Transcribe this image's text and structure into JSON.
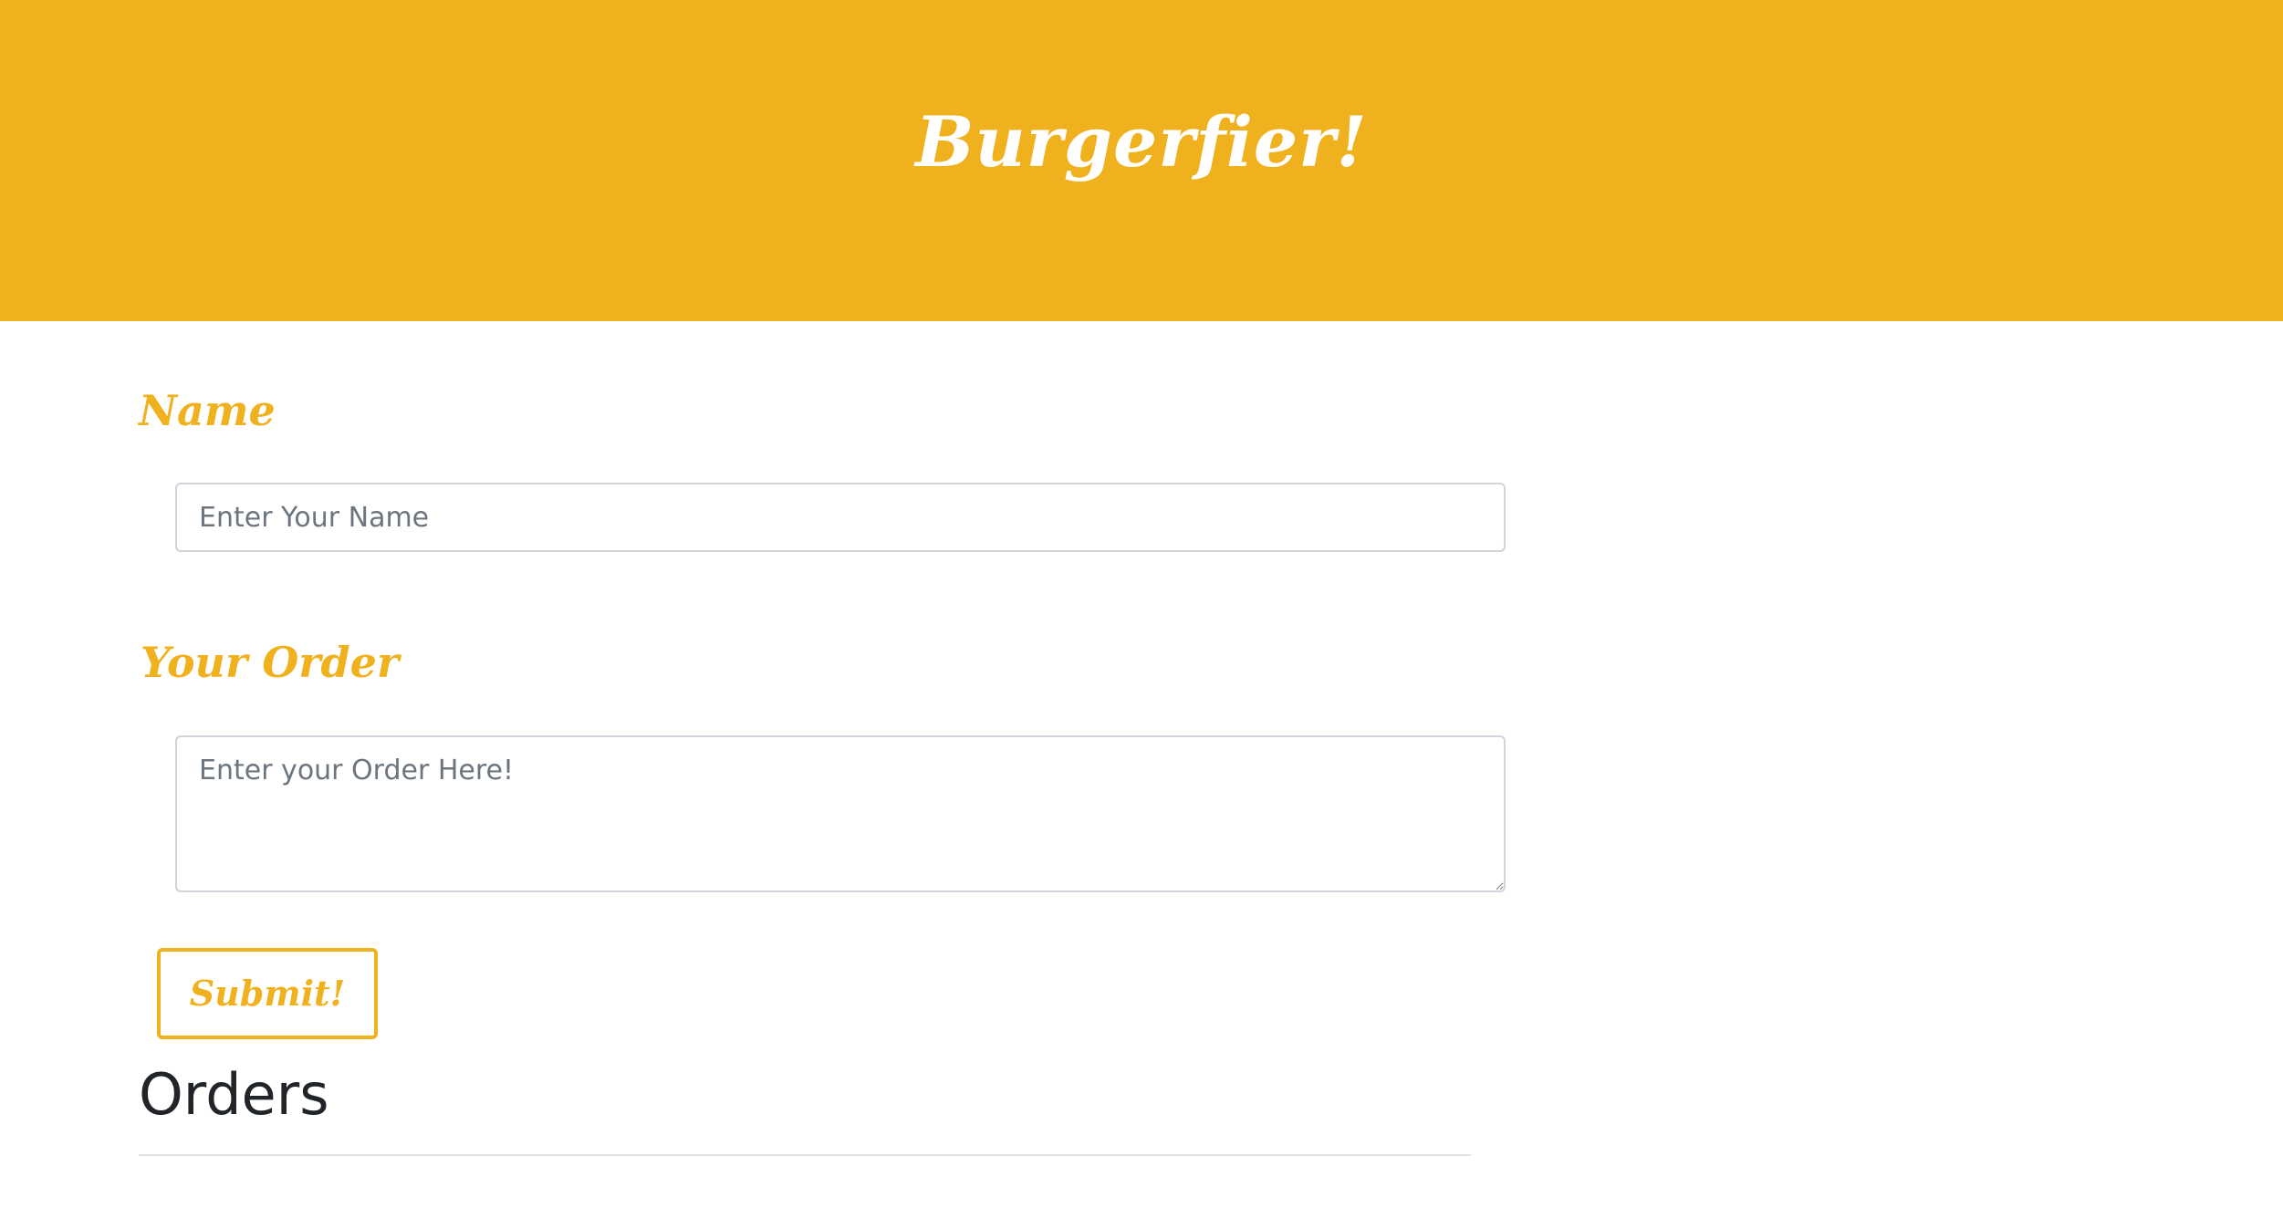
{
  "header": {
    "title": "Burgerfier!"
  },
  "form": {
    "name_label": "Name",
    "name_placeholder": "Enter Your Name",
    "name_value": "",
    "order_label": "Your Order",
    "order_placeholder": "Enter your Order Here!",
    "order_value": "",
    "submit_label": "Submit!"
  },
  "orders": {
    "title": "Orders",
    "items": []
  },
  "colors": {
    "brand": "#f0b11f",
    "text_dark": "#212529",
    "placeholder": "#6c757d",
    "border": "#ced4da"
  }
}
